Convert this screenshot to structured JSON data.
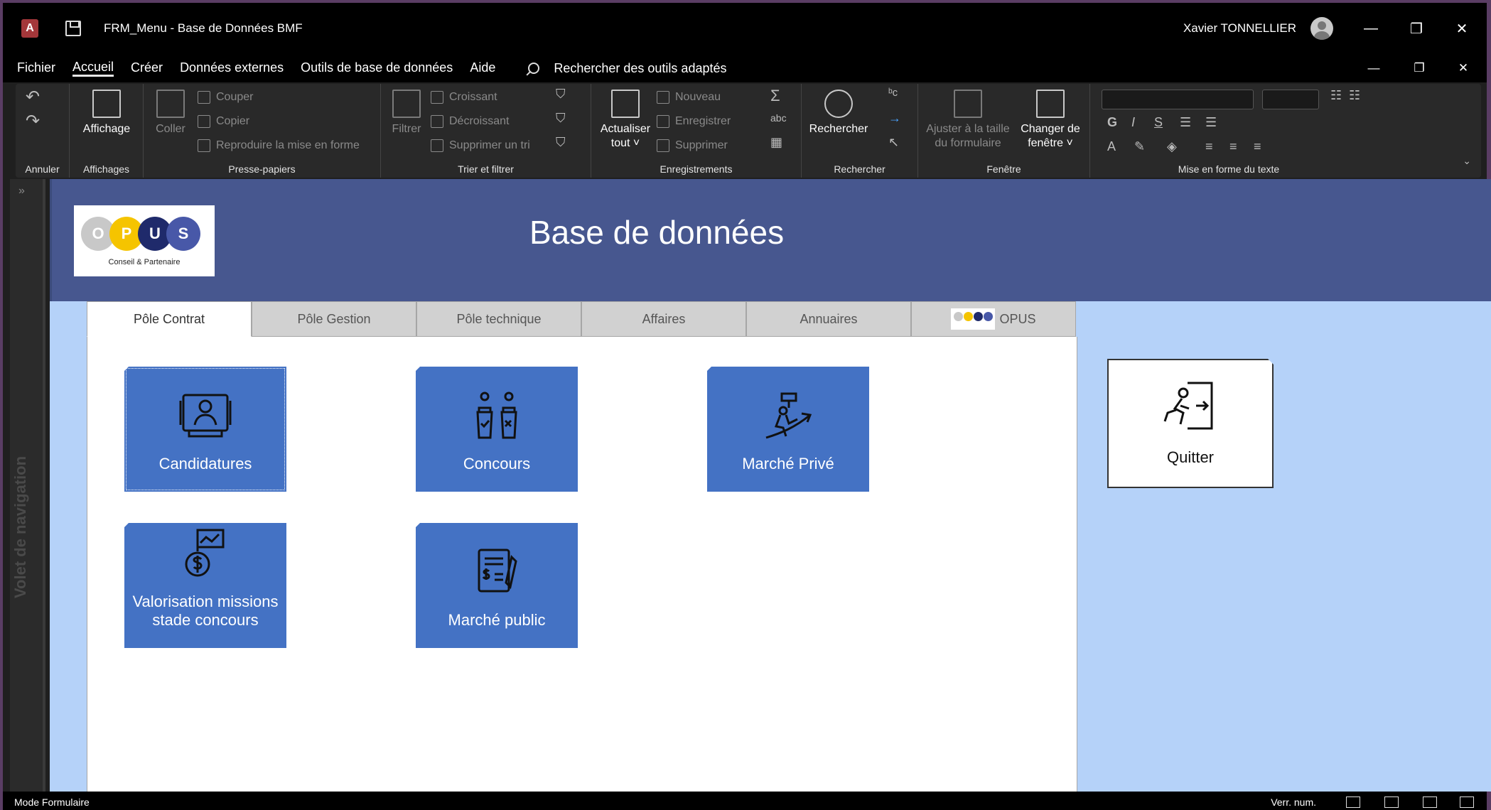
{
  "window": {
    "title": "FRM_Menu  -  Base de Données BMF",
    "user": "Xavier TONNELLIER",
    "app_icon_letter": "A",
    "controls": [
      "—",
      "❐",
      "✕"
    ],
    "inner_controls": [
      "—",
      "❐",
      "✕"
    ]
  },
  "menu": {
    "items": [
      "Fichier",
      "Accueil",
      "Créer",
      "Données externes",
      "Outils de base de données",
      "Aide"
    ],
    "active": "Accueil",
    "tell_me": "Rechercher des outils adaptés"
  },
  "ribbon": {
    "groups": {
      "annuler": "Annuler",
      "affichages": "Affichages",
      "presse_papiers": "Presse-papiers",
      "trier": "Trier et filtrer",
      "enregistrements": "Enregistrements",
      "rechercher": "Rechercher",
      "fenetre": "Fenêtre",
      "mise_en_forme": "Mise en forme du texte"
    },
    "buttons": {
      "affichage": "Affichage",
      "coller": "Coller",
      "couper": "Couper",
      "copier": "Copier",
      "reproduire": "Reproduire la mise en forme",
      "filtrer": "Filtrer",
      "croissant": "Croissant",
      "decroissant": "Décroissant",
      "supprimer_tri": "Supprimer un tri",
      "actualiser": "Actualiser",
      "actualiser2": "tout ˅",
      "nouveau": "Nouveau",
      "enregistrer": "Enregistrer",
      "supprimer": "Supprimer",
      "rechercher": "Rechercher",
      "ajuster": "Ajuster à la taille",
      "ajuster2": "du formulaire",
      "changer": "Changer de",
      "changer2": "fenêtre ˅"
    }
  },
  "nav_pane": {
    "label": "Volet de navigation"
  },
  "form": {
    "title": "Base de données",
    "logo": {
      "letters": [
        "O",
        "P",
        "U",
        "S"
      ],
      "colors": [
        "#c8c8c8",
        "#f5c400",
        "#1f2a6b",
        "#4858a8"
      ],
      "tagline": "Conseil & Partenaire"
    },
    "tabs": [
      "Pôle Contrat",
      "Pôle Gestion",
      "Pôle technique",
      "Affaires",
      "Annuaires",
      "OPUS"
    ],
    "active_tab": "Pôle Contrat",
    "tiles": {
      "candidatures": "Candidatures",
      "concours": "Concours",
      "marche_prive": "Marché Privé",
      "valorisation_1": "Valorisation missions",
      "valorisation_2": "stade concours",
      "marche_public": "Marché public"
    },
    "quit": "Quitter"
  },
  "status": {
    "mode": "Mode Formulaire",
    "numlock": "Verr. num."
  },
  "colors": {
    "header": "#47578f",
    "tile": "#4472c4",
    "form_bg": "#b5d2f9"
  }
}
